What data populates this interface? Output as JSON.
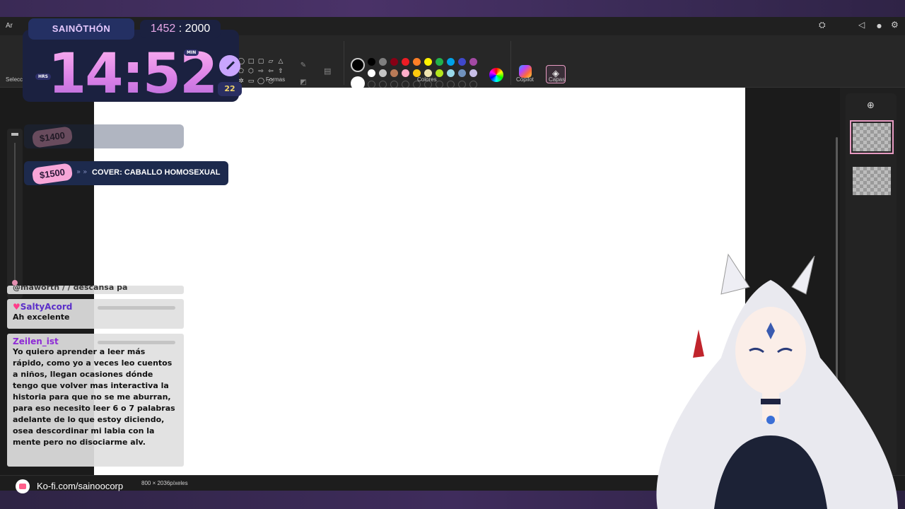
{
  "app": {
    "title_left": "Ar",
    "sections": {
      "select": "Selecci",
      "shapes": "Formas",
      "colors": "Colores",
      "copilot": "Copilot",
      "layers": "Capas"
    },
    "status_dims": "800 × 2036píxeles"
  },
  "overlay": {
    "title": "SAINŌTHÓN",
    "goal_current": "1452",
    "goal_sep": ":",
    "goal_total": "2000",
    "time": "14:52",
    "hrs_label": "HRS",
    "min_label": "MIN",
    "seconds": "22",
    "goals": [
      {
        "price": "$1400",
        "text": "",
        "faded": true
      },
      {
        "price": "$1500",
        "text": "COVER: CABALLO HOMOSEXUAL",
        "faded": false
      }
    ]
  },
  "chat": {
    "messages": [
      {
        "name": "",
        "text": "@maworth / / descansa pa",
        "color": "#333333"
      },
      {
        "name": "SaltyAcord",
        "text": "Ah excelente",
        "color": "#5b2fc9"
      },
      {
        "name": "Zeilen_ist",
        "text": "Yo quiero aprender a leer más rápido, como yo a veces leo cuentos a niños, llegan ocasiones dónde tengo que volver mas interactiva la historia para que no se me aburran, para eso necesito leer 6 o 7 palabras adelante de lo que estoy diciendo, osea descordinar mi labia con la mente pero no disociarme alv.",
        "color": "#8e2bd6"
      }
    ]
  },
  "kofi": {
    "url": "Ko-fi.com/sainoocorp"
  },
  "colors": {
    "accent": "#e79bc2",
    "palette_row1": [
      "#000000",
      "#7f7f7f",
      "#880015",
      "#ed1c24",
      "#ff7f27",
      "#fff200",
      "#22b14c",
      "#00a2e8",
      "#3f48cc",
      "#a349a4"
    ],
    "palette_row2": [
      "#ffffff",
      "#c3c3c3",
      "#b97a57",
      "#ffaec9",
      "#ffc90e",
      "#efe4b0",
      "#b5e61d",
      "#99d9ea",
      "#7092be",
      "#c8bfe7"
    ]
  }
}
